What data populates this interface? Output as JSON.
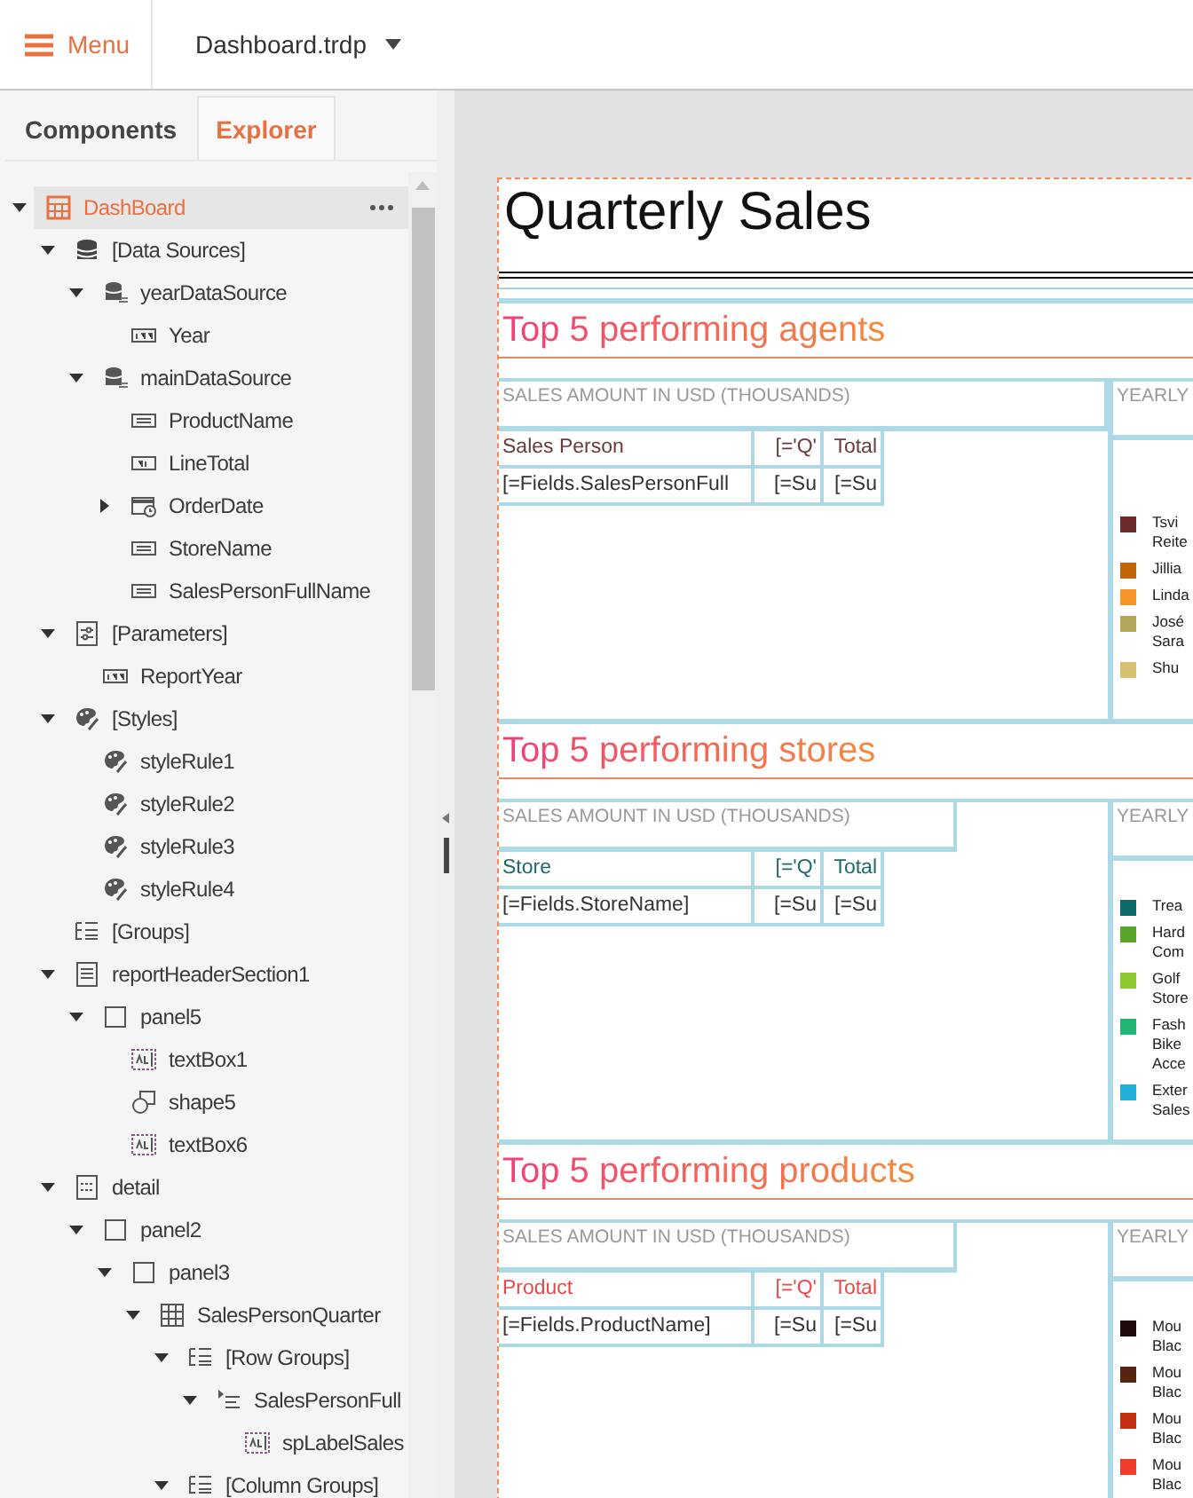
{
  "toolbar": {
    "menu_label": "Menu",
    "document": "Dashboard.trdp"
  },
  "panel_tabs": [
    {
      "label": "Components",
      "selected": false
    },
    {
      "label": "Explorer",
      "selected": true
    }
  ],
  "tree": [
    {
      "label": "DashBoard",
      "kind": "report",
      "selected": true,
      "expanded": true,
      "children": [
        {
          "label": "[Data Sources]",
          "kind": "databases",
          "selected": false,
          "expanded": true,
          "children": [
            {
              "label": "yearDataSource",
              "kind": "sql",
              "selected": false,
              "expanded": true,
              "children": [
                {
                  "label": "Year",
                  "kind": "number",
                  "selected": false
                }
              ]
            },
            {
              "label": "mainDataSource",
              "kind": "sql",
              "selected": false,
              "expanded": true,
              "children": [
                {
                  "label": "ProductName",
                  "kind": "text",
                  "selected": false
                },
                {
                  "label": "LineTotal",
                  "kind": "decimal",
                  "selected": false
                },
                {
                  "label": "OrderDate",
                  "kind": "date",
                  "selected": false,
                  "expanded": false
                },
                {
                  "label": "StoreName",
                  "kind": "text",
                  "selected": false
                },
                {
                  "label": "SalesPersonFullName",
                  "kind": "text",
                  "selected": false
                }
              ]
            }
          ]
        },
        {
          "label": "[Parameters]",
          "kind": "parameters",
          "selected": false,
          "expanded": true,
          "children": [
            {
              "label": "ReportYear",
              "kind": "number",
              "selected": false
            }
          ]
        },
        {
          "label": "[Styles]",
          "kind": "styles",
          "selected": false,
          "expanded": true,
          "children": [
            {
              "label": "styleRule1",
              "kind": "styles",
              "selected": false
            },
            {
              "label": "styleRule2",
              "kind": "styles",
              "selected": false
            },
            {
              "label": "styleRule3",
              "kind": "styles",
              "selected": false
            },
            {
              "label": "styleRule4",
              "kind": "styles",
              "selected": false
            }
          ]
        },
        {
          "label": "[Groups]",
          "kind": "groups",
          "selected": false
        },
        {
          "label": "reportHeaderSection1",
          "kind": "section",
          "selected": false,
          "expanded": true,
          "children": [
            {
              "label": "panel5",
              "kind": "panel",
              "selected": false,
              "expanded": true,
              "children": [
                {
                  "label": "textBox1",
                  "kind": "textbox",
                  "selected": false
                },
                {
                  "label": "shape5",
                  "kind": "shape",
                  "selected": false
                },
                {
                  "label": "textBox6",
                  "kind": "textbox",
                  "selected": false
                }
              ]
            }
          ]
        },
        {
          "label": "detail",
          "kind": "detail",
          "selected": false,
          "expanded": true,
          "children": [
            {
              "label": "panel2",
              "kind": "panel",
              "selected": false,
              "expanded": true,
              "children": [
                {
                  "label": "panel3",
                  "kind": "panel",
                  "selected": false,
                  "expanded": true,
                  "children": [
                    {
                      "label": "SalesPersonQuarter",
                      "kind": "table",
                      "selected": false,
                      "expanded": true,
                      "children": [
                        {
                          "label": "[Row Groups]",
                          "kind": "groups",
                          "selected": false,
                          "expanded": true,
                          "children": [
                            {
                              "label": "SalesPersonFull",
                              "kind": "group",
                              "selected": false,
                              "expanded": true,
                              "children": [
                                {
                                  "label": "spLabelSales",
                                  "kind": "textbox",
                                  "selected": false
                                }
                              ]
                            }
                          ]
                        },
                        {
                          "label": "[Column Groups]",
                          "kind": "groups",
                          "selected": false,
                          "expanded": true
                        }
                      ]
                    }
                  ]
                }
              ]
            }
          ]
        }
      ]
    }
  ],
  "report": {
    "title": "Quarterly Sales",
    "sections": [
      {
        "title": "Top 5 performing agents",
        "header": "SALES AMOUNT IN USD (THOUSANDS)",
        "chart_header": "YEARLY",
        "color": "#6b3a3a",
        "columns": [
          "Sales Person",
          "[='Q'",
          "Total"
        ],
        "cells": [
          "[=Fields.SalesPersonFull",
          "[=Su",
          "[=Su"
        ],
        "legend": [
          {
            "lines": [
              "Tsvi",
              "Reite"
            ],
            "color": "#6e2b2b"
          },
          {
            "lines": [
              "Jillia"
            ],
            "color": "#c1670a"
          },
          {
            "lines": [
              "Linda"
            ],
            "color": "#f7952a"
          },
          {
            "lines": [
              "José",
              "Sara"
            ],
            "color": "#b3a55a"
          },
          {
            "lines": [
              "Shu"
            ],
            "color": "#d6c171"
          }
        ]
      },
      {
        "title": "Top 5 performing stores",
        "header": "SALES AMOUNT IN USD (THOUSANDS)",
        "chart_header": "YEARLY",
        "color": "#1f6b6b",
        "columns": [
          "Store",
          "[='Q'",
          "Total"
        ],
        "cells": [
          "[=Fields.StoreName]",
          "[=Su",
          "[=Su"
        ],
        "legend": [
          {
            "lines": [
              "Trea"
            ],
            "color": "#0e6b6b"
          },
          {
            "lines": [
              "Hard",
              "Com"
            ],
            "color": "#58a52a"
          },
          {
            "lines": [
              "Golf",
              "Store"
            ],
            "color": "#8dc932"
          },
          {
            "lines": [
              "Fash",
              "Bike",
              "Acce"
            ],
            "color": "#22b573"
          },
          {
            "lines": [
              "Exter",
              "Sales"
            ],
            "color": "#1fafd8"
          }
        ]
      },
      {
        "title": "Top 5 performing products",
        "header": "SALES AMOUNT IN USD (THOUSANDS)",
        "chart_header": "YEARLY",
        "color": "#e8484a",
        "columns": [
          "Product",
          "[='Q'",
          "Total"
        ],
        "cells": [
          "[=Fields.ProductName]",
          "[=Su",
          "[=Su"
        ],
        "legend": [
          {
            "lines": [
              "Mou",
              "Blac"
            ],
            "color": "#1e0a0a"
          },
          {
            "lines": [
              "Mou",
              "Blac"
            ],
            "color": "#552512"
          },
          {
            "lines": [
              "Mou",
              "Blac"
            ],
            "color": "#c52e10"
          },
          {
            "lines": [
              "Mou",
              "Blac"
            ],
            "color": "#ee3d2a"
          }
        ]
      }
    ]
  }
}
